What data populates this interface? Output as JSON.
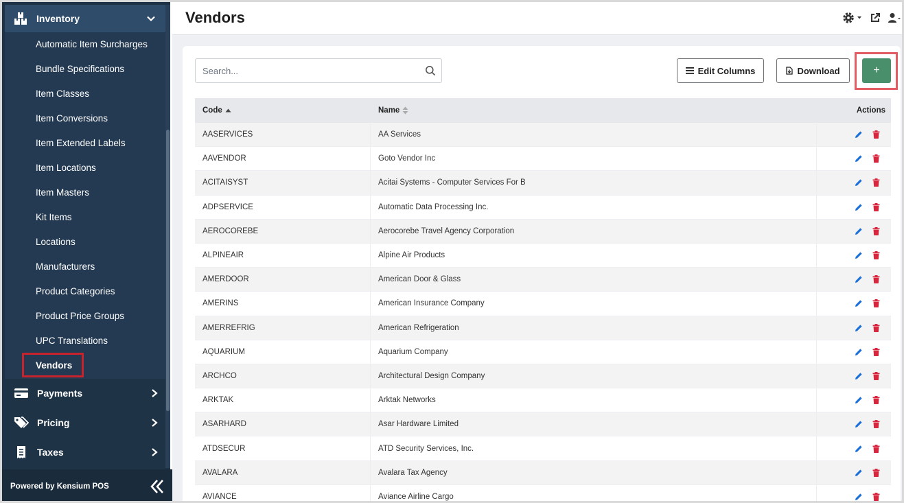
{
  "sidebar": {
    "inventory_label": "Inventory",
    "sub_items": [
      "Automatic Item Surcharges",
      "Bundle Specifications",
      "Item Classes",
      "Item Conversions",
      "Item Extended Labels",
      "Item Locations",
      "Item Masters",
      "Kit Items",
      "Locations",
      "Manufacturers",
      "Product Categories",
      "Product Price Groups",
      "UPC Translations",
      "Vendors"
    ],
    "active_item": "Vendors",
    "groups": [
      {
        "label": "Payments",
        "icon": "credit-card-icon"
      },
      {
        "label": "Pricing",
        "icon": "tags-icon"
      },
      {
        "label": "Taxes",
        "icon": "receipt-icon"
      }
    ],
    "footer": "Powered by Kensium POS"
  },
  "header": {
    "title": "Vendors"
  },
  "toolbar": {
    "search_placeholder": "Search...",
    "edit_columns_label": "Edit Columns",
    "download_label": "Download",
    "add_label": "+"
  },
  "table": {
    "columns": {
      "code": "Code",
      "name": "Name",
      "actions": "Actions"
    },
    "rows": [
      {
        "code": "AASERVICES",
        "name": "AA Services"
      },
      {
        "code": "AAVENDOR",
        "name": "Goto Vendor Inc"
      },
      {
        "code": "ACITAISYST",
        "name": "Acitai Systems - Computer Services For B"
      },
      {
        "code": "ADPSERVICE",
        "name": "Automatic Data Processing Inc."
      },
      {
        "code": "AEROCOREBE",
        "name": "Aerocorebe Travel Agency Corporation"
      },
      {
        "code": "ALPINEAIR",
        "name": "Alpine Air Products"
      },
      {
        "code": "AMERDOOR",
        "name": "American Door & Glass"
      },
      {
        "code": "AMERINS",
        "name": "American Insurance Company"
      },
      {
        "code": "AMERREFRIG",
        "name": "American Refrigeration"
      },
      {
        "code": "AQUARIUM",
        "name": "Aquarium Company"
      },
      {
        "code": "ARCHCO",
        "name": "Architectural Design Company"
      },
      {
        "code": "ARKTAK",
        "name": "Arktak Networks"
      },
      {
        "code": "ASARHARD",
        "name": "Asar Hardware Limited"
      },
      {
        "code": "ATDSECUR",
        "name": "ATD Security Services, Inc."
      },
      {
        "code": "AVALARA",
        "name": "Avalara Tax Agency"
      },
      {
        "code": "AVIANCE",
        "name": "Aviance Airline Cargo"
      }
    ]
  },
  "colors": {
    "sidebar_bg": "#1f3347",
    "add_button": "#4a8f6b",
    "highlight": "#c8232c",
    "edit_icon": "#1a6fd8",
    "delete_icon": "#d7263d"
  }
}
